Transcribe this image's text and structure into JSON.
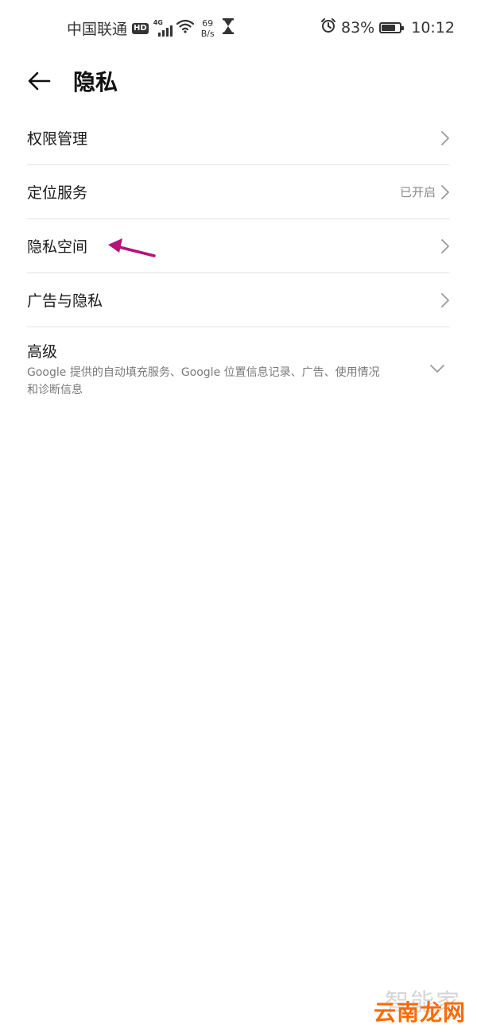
{
  "status_bar": {
    "carrier": "中国联通",
    "hd_badge": "HD",
    "network": "4G",
    "speed_value": "69",
    "speed_unit": "B/s",
    "battery_percent": "83%",
    "battery_level": 0.83,
    "time": "10:12",
    "icons": [
      "signal-icon",
      "wifi-icon",
      "hourglass-icon",
      "alarm-icon",
      "battery-icon"
    ]
  },
  "header": {
    "back_icon": "back-arrow-icon",
    "title": "隐私"
  },
  "items": [
    {
      "label": "权限管理",
      "value": ""
    },
    {
      "label": "定位服务",
      "value": "已开启"
    },
    {
      "label": "隐私空间",
      "value": ""
    },
    {
      "label": "广告与隐私",
      "value": ""
    }
  ],
  "advanced": {
    "title": "高级",
    "description": "Google 提供的自动填充服务、Google 位置信息记录、广告、使用情况和诊断信息"
  },
  "annotation": {
    "color": "#b5127a"
  },
  "watermark": {
    "line1": "智能家",
    "line2": "云南龙网"
  }
}
